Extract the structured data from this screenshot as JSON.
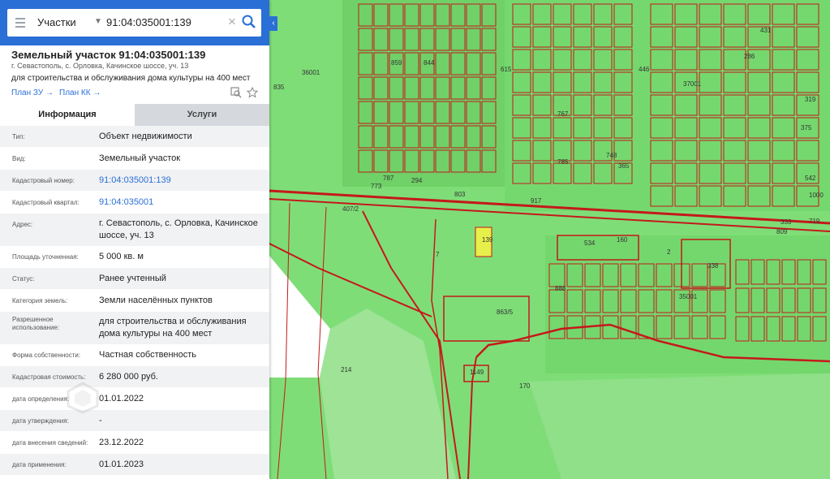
{
  "search": {
    "scope": "Участки",
    "query": "91:04:035001:139"
  },
  "object": {
    "title": "Земельный участок 91:04:035001:139",
    "address": "г. Севастополь, с. Орловка, Качинское шоссе, уч. 13",
    "purpose": "для строительства и обслуживания дома культуры на 400 мест",
    "plan_zu": "План ЗУ",
    "plan_kk": "План КК"
  },
  "tabs": {
    "info": "Информация",
    "services": "Услуги"
  },
  "rows": [
    {
      "label": "Тип:",
      "value": "Объект недвижимости"
    },
    {
      "label": "Вид:",
      "value": "Земельный участок"
    },
    {
      "label": "Кадастровый номер:",
      "value": "91:04:035001:139"
    },
    {
      "label": "Кадастровый квартал:",
      "value": "91:04:035001"
    },
    {
      "label": "Адрес:",
      "value": "г. Севастополь, с. Орловка, Качинское шоссе, уч. 13"
    },
    {
      "label": "Площадь уточненная:",
      "value": "5 000 кв. м"
    },
    {
      "label": "Статус:",
      "value": "Ранее учтенный"
    },
    {
      "label": "Категория земель:",
      "value": "Земли населённых пунктов"
    },
    {
      "label": "Разрешенное использование:",
      "value": "для строительства и обслуживания дома культуры на 400 мест"
    },
    {
      "label": "Форма собственности:",
      "value": "Частная собственность"
    },
    {
      "label": "Кадастровая стоимость:",
      "value": "6 280 000 руб."
    },
    {
      "label": "дата определения:",
      "value": "01.01.2022"
    },
    {
      "label": "дата утверждения:",
      "value": "-"
    },
    {
      "label": "дата внесения сведений:",
      "value": "23.12.2022"
    },
    {
      "label": "дата применения:",
      "value": "01.01.2023"
    }
  ],
  "map": {
    "labels": [
      "36001",
      "859",
      "844",
      "615",
      "431",
      "286",
      "446",
      "37001",
      "319",
      "835",
      "767",
      "375",
      "917",
      "407/2",
      "7",
      "534",
      "160",
      "338",
      "35001",
      "863/5",
      "214",
      "1149",
      "170",
      "1000",
      "719",
      "333",
      "809",
      "542",
      "365",
      "803",
      "787",
      "773",
      "748",
      "785",
      "294",
      "2",
      "888",
      "139"
    ]
  },
  "colors": {
    "header": "#2a6fd6",
    "map_green": "#7fdd77",
    "parcel_line": "#c4191b",
    "highlight": "#e6f04a"
  }
}
